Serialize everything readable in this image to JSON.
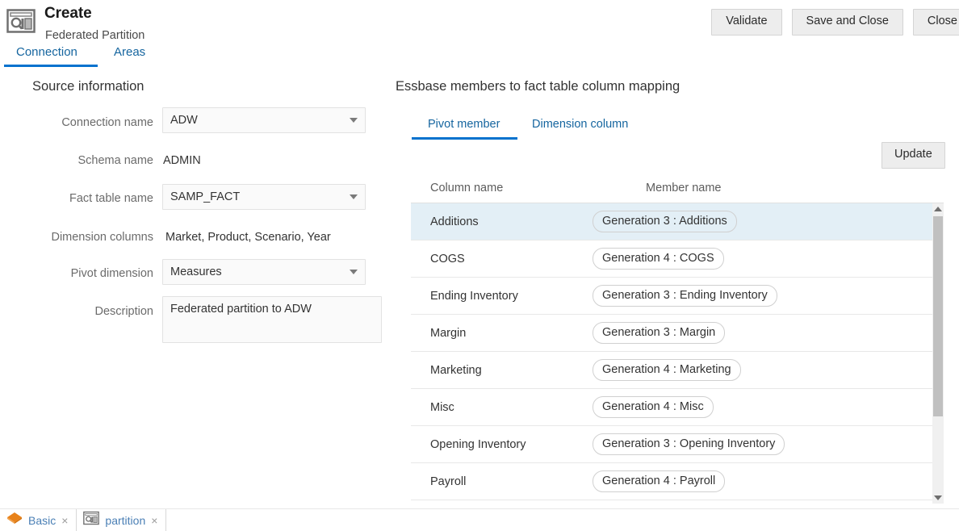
{
  "header": {
    "icon": "partition-window-icon",
    "title": "Create",
    "subtitle": "Federated Partition",
    "buttons": [
      {
        "label": "Validate",
        "name": "validate-button"
      },
      {
        "label": "Save and Close",
        "name": "save-and-close-button"
      },
      {
        "label": "Close",
        "name": "close-button"
      }
    ]
  },
  "main_tabs": [
    {
      "label": "Connection",
      "active": true
    },
    {
      "label": "Areas",
      "active": false
    }
  ],
  "source": {
    "section_title": "Source information",
    "fields": {
      "connection_name_label": "Connection name",
      "connection_name_value": "ADW",
      "schema_name_label": "Schema name",
      "schema_name_value": "ADMIN",
      "fact_table_label": "Fact table name",
      "fact_table_value": "SAMP_FACT",
      "dimension_columns_label": "Dimension columns",
      "dimension_columns_value": "Market, Product, Scenario, Year",
      "pivot_dimension_label": "Pivot dimension",
      "pivot_dimension_value": "Measures",
      "description_label": "Description",
      "description_value": "Federated partition to ADW"
    }
  },
  "mapping": {
    "section_title": "Essbase members to fact table column mapping",
    "tabs": [
      {
        "label": "Pivot member",
        "active": true
      },
      {
        "label": "Dimension column",
        "active": false
      }
    ],
    "update_label": "Update",
    "columns": [
      "Column name",
      "Member name"
    ],
    "rows": [
      {
        "column": "Additions",
        "member": "Generation 3 : Additions",
        "selected": true
      },
      {
        "column": "COGS",
        "member": "Generation 4 : COGS",
        "selected": false
      },
      {
        "column": "Ending Inventory",
        "member": "Generation 3 : Ending Inventory",
        "selected": false
      },
      {
        "column": "Margin",
        "member": "Generation 3 : Margin",
        "selected": false
      },
      {
        "column": "Marketing",
        "member": "Generation 4 : Marketing",
        "selected": false
      },
      {
        "column": "Misc",
        "member": "Generation 4 : Misc",
        "selected": false
      },
      {
        "column": "Opening Inventory",
        "member": "Generation 3 : Opening Inventory",
        "selected": false
      },
      {
        "column": "Payroll",
        "member": "Generation 4 : Payroll",
        "selected": false
      }
    ]
  },
  "taskbar": [
    {
      "label": "Basic",
      "icon": "cube-icon",
      "close": "×"
    },
    {
      "label": "partition",
      "icon": "partition-window-icon",
      "close": "×"
    }
  ],
  "colors": {
    "accent": "#0572ce",
    "link": "#15659f",
    "selected_row": "#e3eff6",
    "button_bg": "#ededed",
    "taskbar_cube": "#e8821a"
  }
}
